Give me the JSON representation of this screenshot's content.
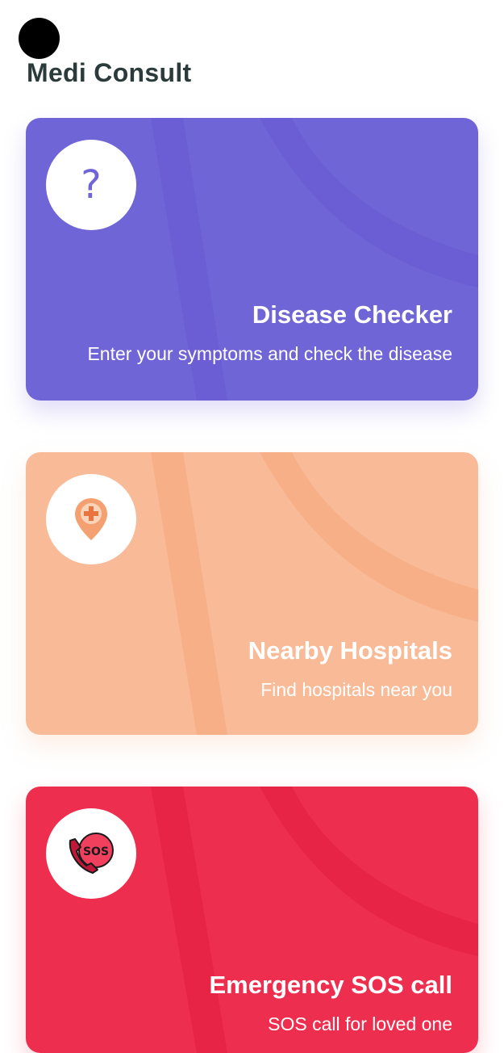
{
  "app": {
    "title": "Medi Consult"
  },
  "cards": [
    {
      "title": "Disease Checker",
      "subtitle": "Enter your symptoms and check the disease",
      "icon": "question-mark-icon",
      "color": "#7065d6"
    },
    {
      "title": "Nearby Hospitals",
      "subtitle": "Find hospitals near you",
      "icon": "hospital-location-pin-icon",
      "color": "#f9bb97"
    },
    {
      "title": "Emergency SOS call",
      "subtitle": "SOS call for loved one",
      "icon": "sos-phone-icon",
      "icon_text": "SOS",
      "color": "#ee2e4e"
    }
  ]
}
